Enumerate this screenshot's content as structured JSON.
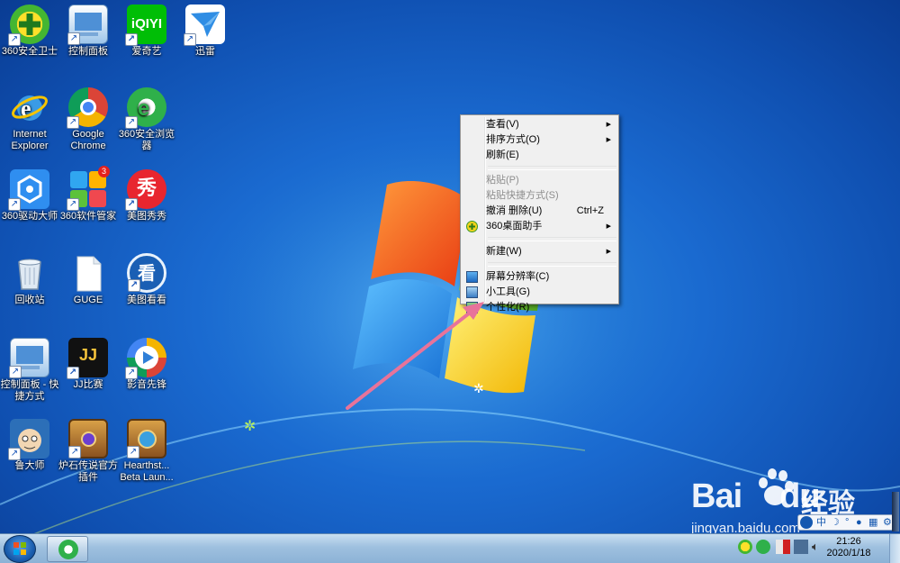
{
  "desktop": {
    "icons": [
      {
        "label": "360安全卫士",
        "icon": "360-safe-icon",
        "shortcut": true
      },
      {
        "label": "控制面板",
        "icon": "control-panel-icon",
        "shortcut": true
      },
      {
        "label": "爱奇艺",
        "icon": "iqiyi-icon",
        "shortcut": true,
        "brand_text": "iQIYI"
      },
      {
        "label": "迅雷",
        "icon": "xunlei-icon",
        "shortcut": true
      },
      {
        "label": "Internet Explorer",
        "icon": "internet-explorer-icon",
        "shortcut": false
      },
      {
        "label": "Google Chrome",
        "icon": "chrome-icon",
        "shortcut": true
      },
      {
        "label": "360安全浏览器",
        "icon": "360-browser-icon",
        "shortcut": true
      },
      {
        "label": "360驱动大师",
        "icon": "360-driver-icon",
        "shortcut": true
      },
      {
        "label": "360软件管家",
        "icon": "360-software-icon",
        "shortcut": true,
        "badge": "3"
      },
      {
        "label": "美图秀秀",
        "icon": "meitu-xiuxiu-icon",
        "shortcut": true,
        "brand_text": "秀"
      },
      {
        "label": "回收站",
        "icon": "recycle-bin-icon",
        "shortcut": false
      },
      {
        "label": "GUGE",
        "icon": "blank-file-icon",
        "shortcut": false
      },
      {
        "label": "美图看看",
        "icon": "meitu-kankan-icon",
        "shortcut": true,
        "brand_text": "看"
      },
      {
        "label": "控制面板 - 快捷方式",
        "icon": "control-panel-shortcut-icon",
        "shortcut": true
      },
      {
        "label": "JJ比赛",
        "icon": "jj-icon",
        "shortcut": true,
        "brand_text": "JJ"
      },
      {
        "label": "影音先锋",
        "icon": "yingyin-icon",
        "shortcut": true
      },
      {
        "label": "鲁大师",
        "icon": "ludashi-icon",
        "shortcut": true
      },
      {
        "label": "炉石传说官方插件",
        "icon": "hearthstone-plugin-icon",
        "shortcut": true
      },
      {
        "label": "Hearthst... Beta Laun...",
        "icon": "hearthstone-launcher-icon",
        "shortcut": true
      }
    ]
  },
  "context_menu": {
    "items": [
      {
        "label": "查看(V)",
        "submenu": true,
        "enabled": true
      },
      {
        "label": "排序方式(O)",
        "submenu": true,
        "enabled": true
      },
      {
        "label": "刷新(E)",
        "enabled": true
      },
      {
        "label": "粘贴(P)",
        "enabled": false
      },
      {
        "label": "粘贴快捷方式(S)",
        "enabled": false
      },
      {
        "label": "撤消 删除(U)",
        "accelerator": "Ctrl+Z",
        "enabled": true
      },
      {
        "label": "360桌面助手",
        "submenu": true,
        "enabled": true,
        "icon": "360-plus-icon"
      },
      {
        "label": "新建(W)",
        "submenu": true,
        "enabled": true
      },
      {
        "label": "屏幕分辨率(C)",
        "enabled": true,
        "icon": "screen-resolution-icon"
      },
      {
        "label": "小工具(G)",
        "enabled": true,
        "icon": "gadgets-icon"
      },
      {
        "label": "个性化(R)",
        "enabled": true,
        "icon": "personalize-icon"
      }
    ]
  },
  "ime_bar": {
    "label": "中"
  },
  "taskbar": {
    "clock_time": "21:26",
    "clock_date": "2020/1/18"
  },
  "watermark": {
    "logo": "Bai",
    "logo_tail": "du",
    "product": "经验",
    "url": "jingyan.baidu.com"
  },
  "colors": {
    "arrow": "#e8739a",
    "menu_bg": "#f0f0f0",
    "desktop": "#1a6ad0"
  }
}
